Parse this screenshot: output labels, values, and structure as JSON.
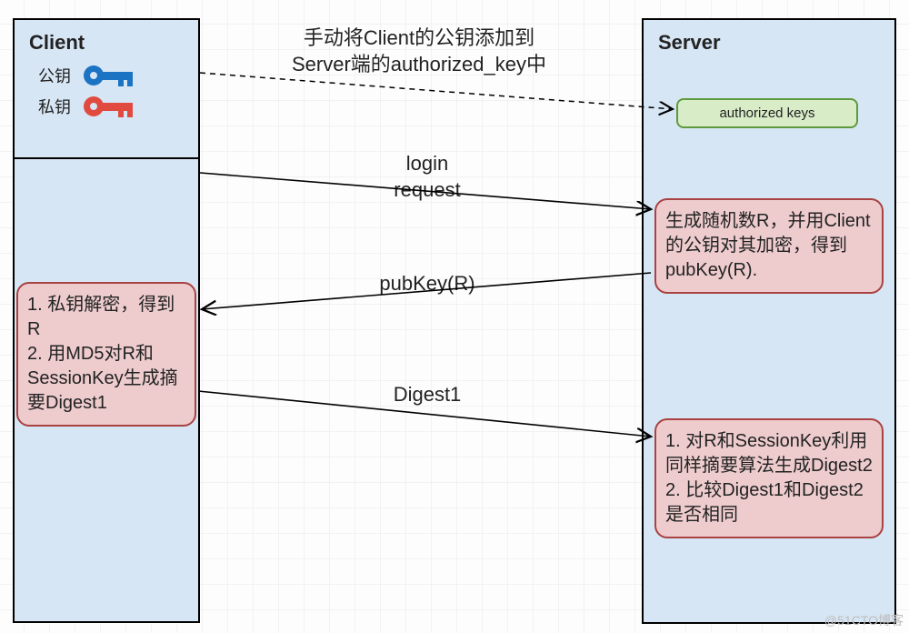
{
  "client": {
    "title": "Client",
    "pubkey_label": "公钥",
    "privkey_label": "私钥"
  },
  "server": {
    "title": "Server",
    "authorized_box": "authorized keys"
  },
  "top_note": "手动将Client的公钥添加到\nServer端的authorized_key中",
  "arrows": {
    "login": "login\nrequest",
    "pubkey_r": "pubKey(R)",
    "digest1": "Digest1"
  },
  "boxes": {
    "server_gen_r": "生成随机数R，并用Client的公钥对其加密，得到pubKey(R).",
    "client_decrypt": "1. 私钥解密，得到R\n2. 用MD5对R和SessionKey生成摘要Digest1",
    "server_compare": "1. 对R和SessionKey利用同样摘要算法生成Digest2\n2. 比较Digest1和Digest2是否相同"
  },
  "watermark": "@51CTO博客",
  "colors": {
    "pubkey": "#1b73c4",
    "privkey": "#e14b3f"
  }
}
